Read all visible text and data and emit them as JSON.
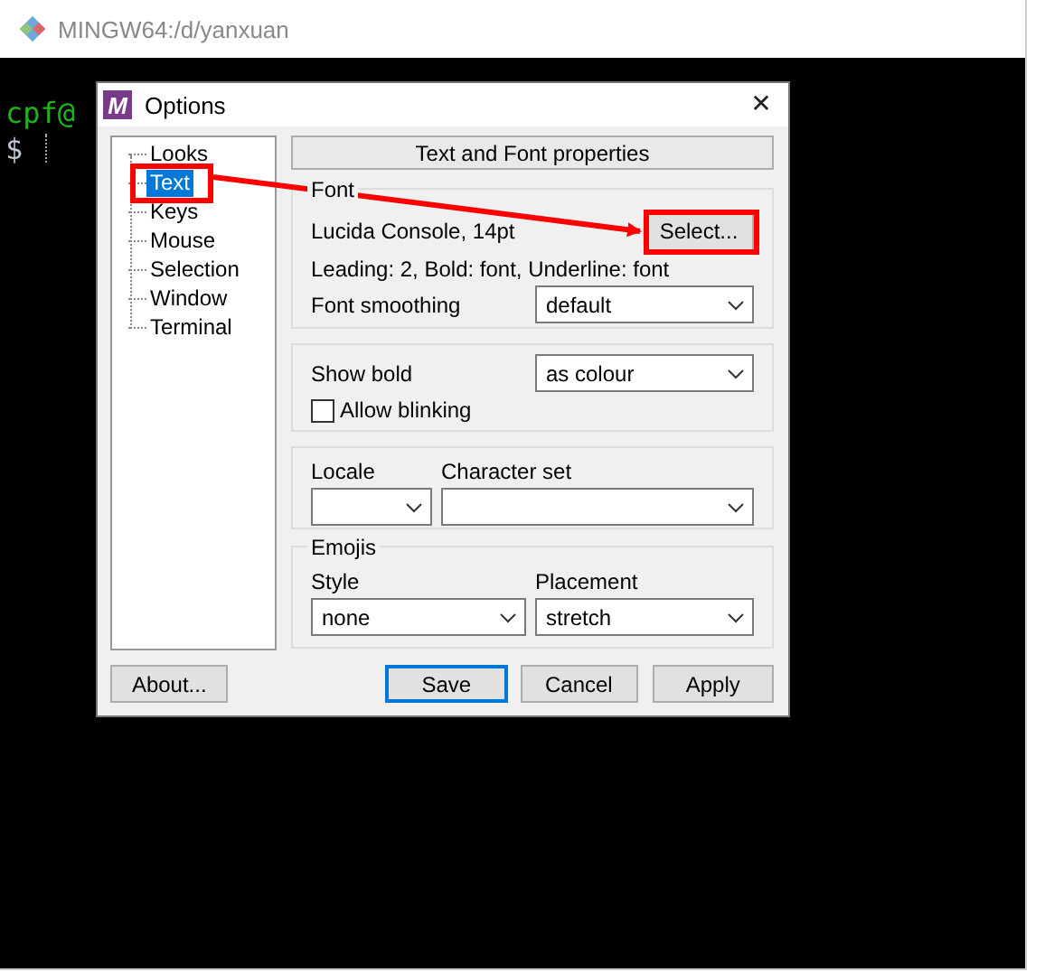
{
  "terminal": {
    "title": "MINGW64:/d/yanxuan",
    "lines": [
      {
        "kind": "prompt-user",
        "text": "cpf@"
      },
      {
        "kind": "prompt",
        "text": "$"
      }
    ]
  },
  "dialog": {
    "logo": "M",
    "title": "Options",
    "close": "✕",
    "tree": [
      {
        "label": "Looks",
        "selected": false
      },
      {
        "label": "Text",
        "selected": true
      },
      {
        "label": "Keys",
        "selected": false
      },
      {
        "label": "Mouse",
        "selected": false
      },
      {
        "label": "Selection",
        "selected": false
      },
      {
        "label": "Window",
        "selected": false
      },
      {
        "label": "Terminal",
        "selected": false
      }
    ],
    "header": "Text and Font properties",
    "font_group": {
      "legend": "Font",
      "font": "Lucida Console, 14pt",
      "select_button": "Select...",
      "details": "Leading: 2, Bold: font, Underline: font",
      "smoothing_label": "Font smoothing",
      "smoothing_value": "default"
    },
    "bold_group": {
      "show_bold_label": "Show bold",
      "show_bold_value": "as colour",
      "allow_blinking": {
        "label": "Allow blinking",
        "checked": false
      }
    },
    "locale_group": {
      "locale_label": "Locale",
      "charset_label": "Character set"
    },
    "emoji_group": {
      "legend": "Emojis",
      "style_label": "Style",
      "style_value": "none",
      "placement_label": "Placement",
      "placement_value": "stretch"
    },
    "buttons": [
      {
        "label": "About...",
        "kind": "plain"
      },
      {
        "label": "Save",
        "kind": "default"
      },
      {
        "label": "Cancel",
        "kind": "plain"
      },
      {
        "label": "Apply",
        "kind": "plain"
      }
    ]
  }
}
